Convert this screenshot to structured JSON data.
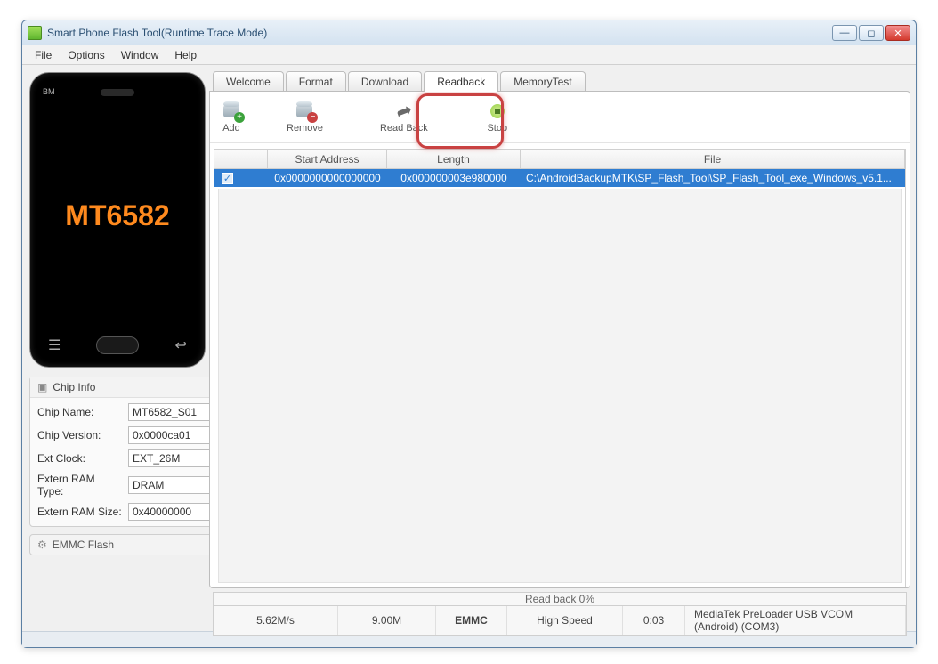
{
  "window": {
    "title": "Smart Phone Flash Tool(Runtime Trace Mode)"
  },
  "menu": {
    "file": "File",
    "options": "Options",
    "window": "Window",
    "help": "Help"
  },
  "phone": {
    "brand": "BM",
    "chip": "MT6582"
  },
  "chipInfo": {
    "panelTitle": "Chip Info",
    "rows": {
      "chipName": {
        "label": "Chip Name:",
        "value": "MT6582_S01"
      },
      "chipVersion": {
        "label": "Chip Version:",
        "value": "0x0000ca01"
      },
      "extClock": {
        "label": "Ext Clock:",
        "value": "EXT_26M"
      },
      "ramType": {
        "label": "Extern RAM Type:",
        "value": "DRAM"
      },
      "ramSize": {
        "label": "Extern RAM Size:",
        "value": "0x40000000"
      }
    }
  },
  "emmc": {
    "label": "EMMC Flash"
  },
  "tabs": {
    "welcome": "Welcome",
    "format": "Format",
    "download": "Download",
    "readback": "Readback",
    "memorytest": "MemoryTest"
  },
  "toolbar": {
    "add": "Add",
    "remove": "Remove",
    "readback": "Read Back",
    "stop": "Stop"
  },
  "grid": {
    "headers": {
      "check": "",
      "start": "Start Address",
      "length": "Length",
      "file": "File"
    },
    "row0": {
      "start": "0x0000000000000000",
      "length": "0x000000003e980000",
      "file": "C:\\AndroidBackupMTK\\SP_Flash_Tool\\SP_Flash_Tool_exe_Windows_v5.1..."
    }
  },
  "status": {
    "progress": "Read back 0%",
    "speed": "5.62M/s",
    "total": "9.00M",
    "storage": "EMMC",
    "mode": "High Speed",
    "time": "0:03",
    "device": "MediaTek PreLoader USB VCOM (Android) (COM3)"
  }
}
